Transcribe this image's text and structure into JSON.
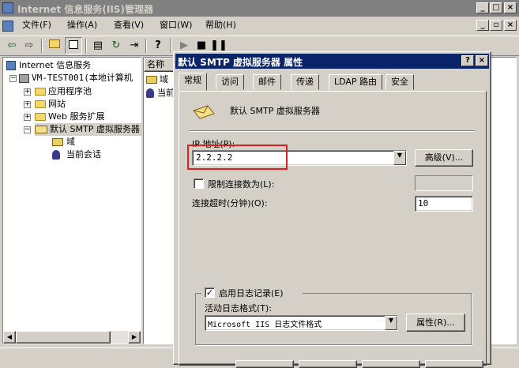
{
  "main_window": {
    "title": "Internet 信息服务(IIS)管理器",
    "caption_buttons": [
      "_",
      "□",
      "×"
    ],
    "menu": [
      {
        "label": "文件(F)"
      },
      {
        "label": "操作(A)"
      },
      {
        "label": "查看(V)"
      },
      {
        "label": "窗口(W)"
      },
      {
        "label": "帮助(H)"
      }
    ],
    "mdi_buttons": [
      "_",
      "▫",
      "×"
    ],
    "toolbar_icons": [
      "back-arrow-icon",
      "forward-arrow-icon",
      "up-folder-icon",
      "show-tree-icon",
      "properties-icon",
      "refresh-icon",
      "export-icon",
      "help-icon",
      "play-icon",
      "stop-icon",
      "pause-icon"
    ]
  },
  "tree": {
    "items": [
      {
        "label": "Internet 信息服务"
      },
      {
        "label": "VM-TEST001(本地计算机"
      },
      {
        "label": "应用程序池"
      },
      {
        "label": "网站"
      },
      {
        "label": "Web 服务扩展"
      },
      {
        "label": "默认 SMTP 虚拟服务器"
      },
      {
        "label": "域"
      },
      {
        "label": "当前会话"
      }
    ]
  },
  "list_pane": {
    "column_header": "名称",
    "items": [
      {
        "label": "域"
      },
      {
        "label": "当前"
      }
    ]
  },
  "dialog": {
    "title": "默认 SMTP 虚拟服务器 属性",
    "help_button": "?",
    "close_button": "×",
    "tabs": [
      {
        "label": "常规",
        "active": true
      },
      {
        "label": "访问"
      },
      {
        "label": "邮件"
      },
      {
        "label": "传递"
      },
      {
        "label": "LDAP 路由"
      },
      {
        "label": "安全"
      }
    ],
    "server_name": "默认 SMTP 虚拟服务器",
    "ip_label": "IP 地址(P):",
    "ip_value": "2.2.2.2",
    "advanced_button": "高级(V)...",
    "limit_connections_label": "限制连接数为(L):",
    "limit_connections_checked": false,
    "limit_connections_value": "",
    "timeout_label": "连接超时(分钟)(O):",
    "timeout_value": "10",
    "enable_logging_label": "启用日志记录(E)",
    "enable_logging_checked": true,
    "log_format_label": "活动日志格式(T):",
    "log_format_value": "Microsoft IIS 日志文件格式",
    "log_properties_button": "属性(R)...",
    "highlight_color": "#e02020"
  }
}
